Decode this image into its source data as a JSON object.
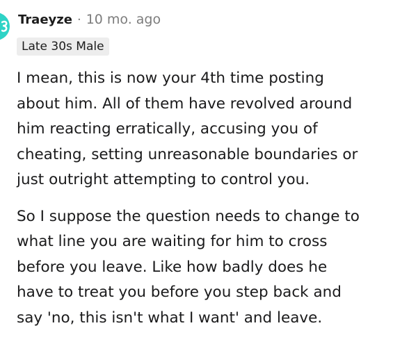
{
  "comment": {
    "author": "Traeyze",
    "separator": "·",
    "time": "10 mo. ago",
    "flair": "Late 30s Male",
    "avatar_color": "#2ed3c6",
    "avatar_icon": "user-avatar-icon",
    "paragraphs": [
      {
        "lines": [
          "I mean, this is now your 4th time posting",
          "about him. All of them have revolved around",
          "him reacting erratically, accusing you of",
          "cheating, setting unreasonable boundaries or",
          "just outright attempting to control you."
        ]
      },
      {
        "lines": [
          "So I suppose the question needs to change to",
          "what line you are waiting for him to cross",
          "before you leave. Like how badly does he",
          "have to treat you before you step back and",
          "say 'no, this isn't what I want' and leave."
        ]
      }
    ]
  }
}
